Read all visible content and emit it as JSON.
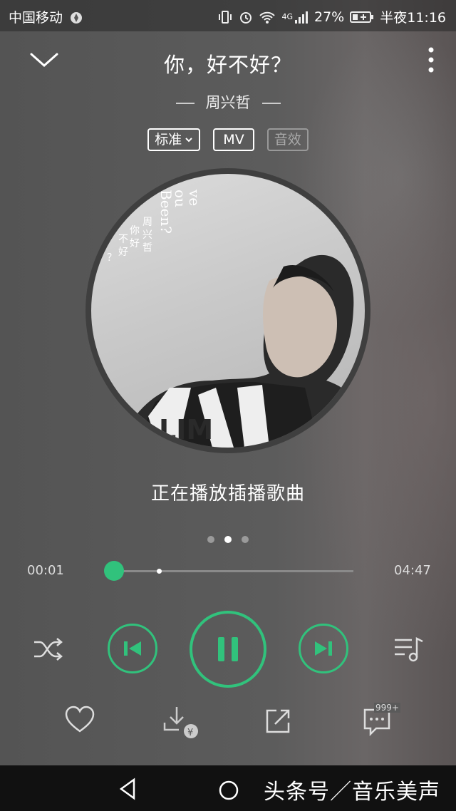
{
  "status": {
    "carrier": "中国移动",
    "battery": "27%",
    "time": "半夜11:16",
    "network": "4G"
  },
  "song": {
    "title": "你，好不好？",
    "artist": "周兴哲"
  },
  "chips": {
    "quality": "标准",
    "mv": "MV",
    "effect": "音效"
  },
  "cover": {
    "line1": "ve",
    "line2": "ou",
    "line3": "Been?",
    "cn1": "你",
    "cn2": "好",
    "cn3": "不",
    "cn4": "好",
    "cn5": "？",
    "cn6": "周",
    "cn7": "兴",
    "cn8": "哲",
    "shirt": "LIM"
  },
  "now_playing": "正在播放插播歌曲",
  "progress": {
    "elapsed": "00:01",
    "total": "04:47",
    "fraction": 0.03
  },
  "pager": {
    "count": 3,
    "active": 1
  },
  "comments": {
    "count": "999+"
  },
  "watermark": "头条号／音乐美声",
  "colors": {
    "accent": "#31c27c"
  }
}
